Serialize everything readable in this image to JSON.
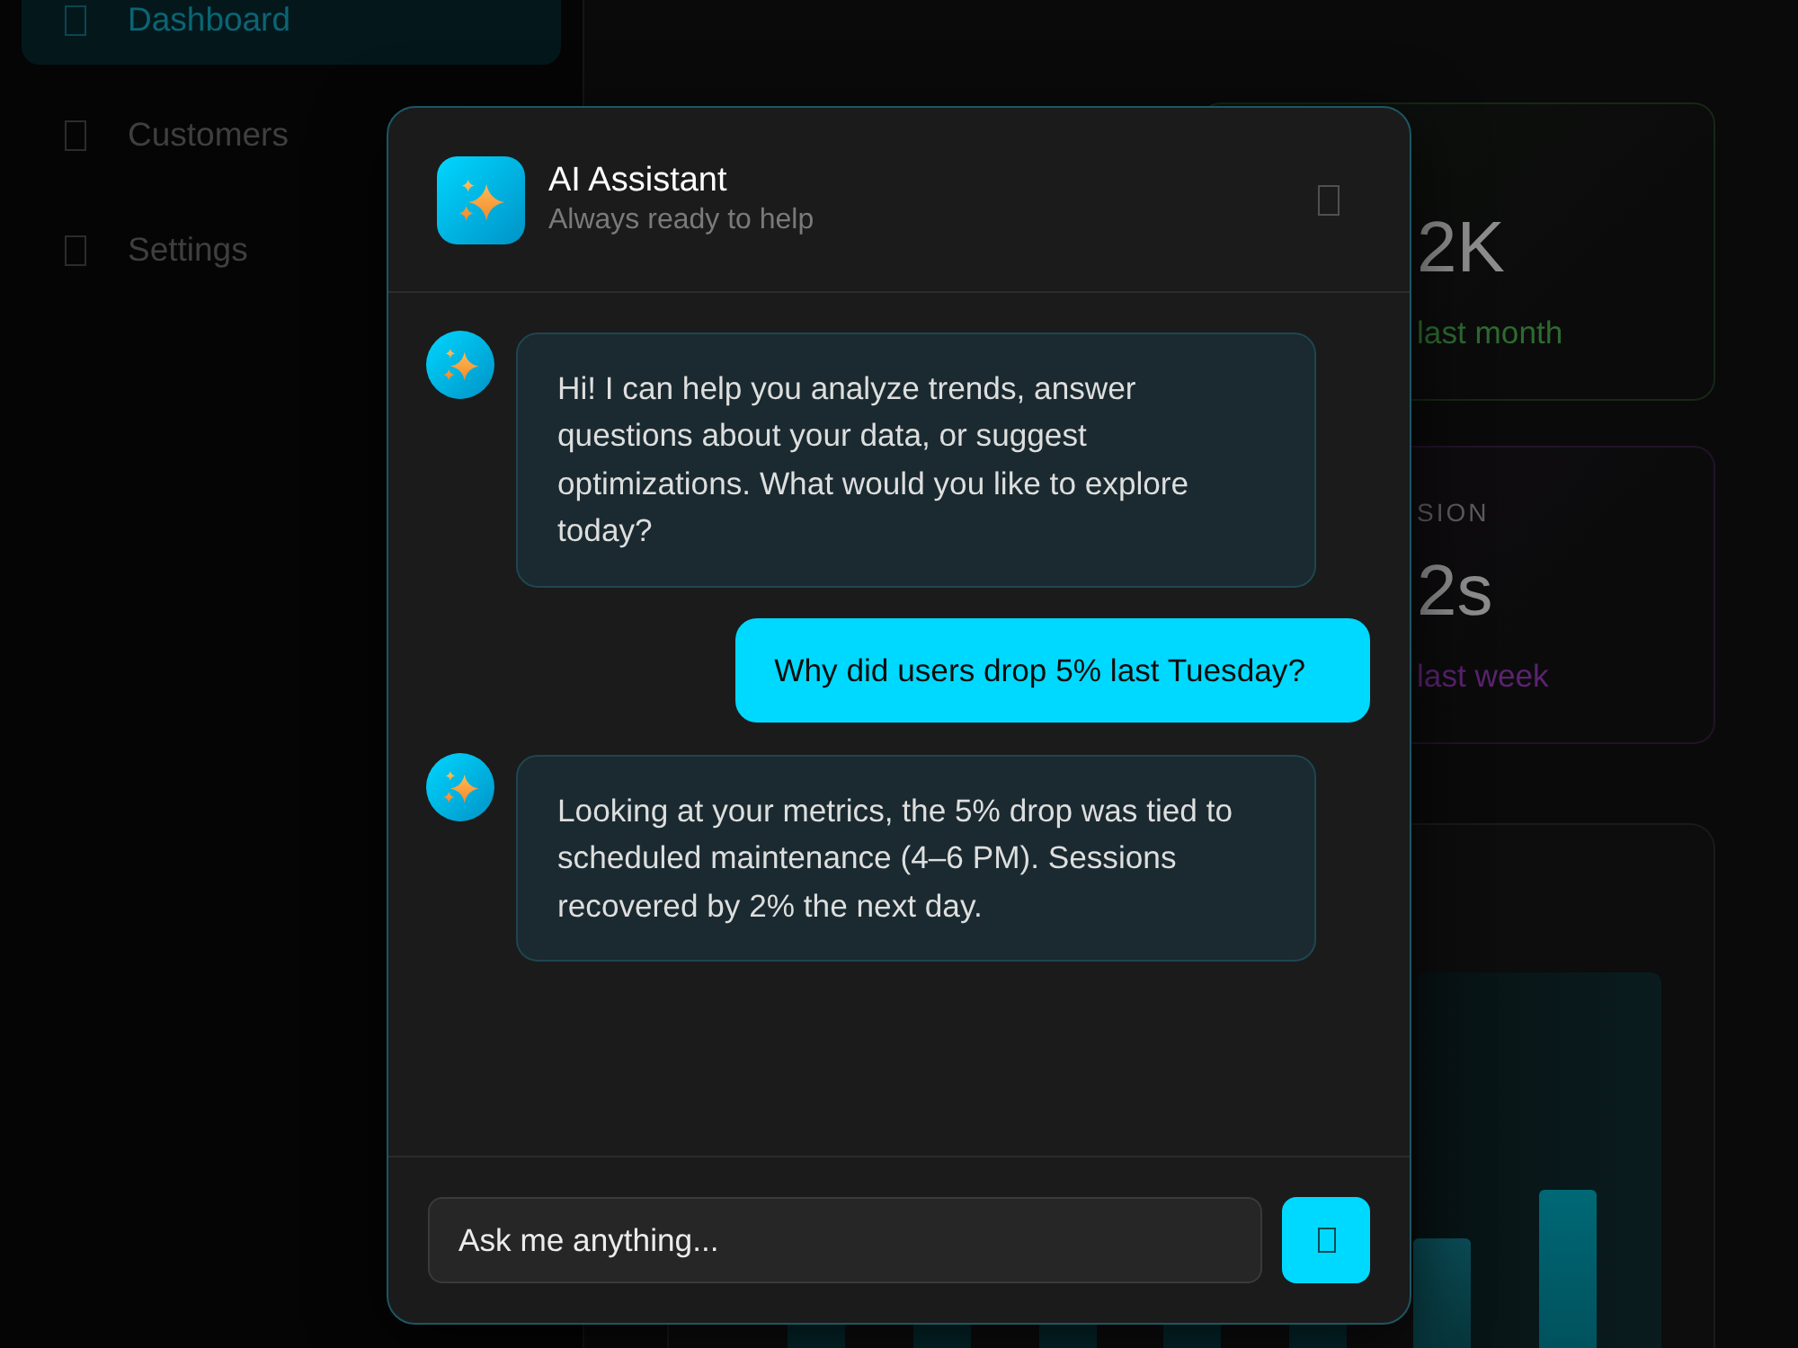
{
  "sidebar": {
    "items": [
      {
        "label": "Dashboard",
        "selected": true
      },
      {
        "label": "Customers",
        "selected": false
      },
      {
        "label": "Settings",
        "selected": false
      }
    ]
  },
  "stat_cards": [
    {
      "value": "2K",
      "change": "last month",
      "color": "#2e6a31"
    },
    {
      "label": "SION",
      "value": "2s",
      "change": "last week",
      "color": "#5b2370"
    }
  ],
  "chat_dialog": {
    "title": "AI Assistant",
    "subtitle": "Always ready to help",
    "messages": [
      {
        "kind": "assistant",
        "text": "Hi! I can help you analyze trends, answer questions about your data, or suggest optimizations. What would you like to explore today?"
      },
      {
        "kind": "user",
        "text": "Why did users drop 5% last Tuesday?"
      },
      {
        "kind": "assistant",
        "text": "Looking at your metrics, the 5% drop was tied to scheduled maintenance (4–6 PM). Sessions recovered by 2% the next day."
      }
    ],
    "input": {
      "placeholder": "Ask me anything..."
    }
  }
}
